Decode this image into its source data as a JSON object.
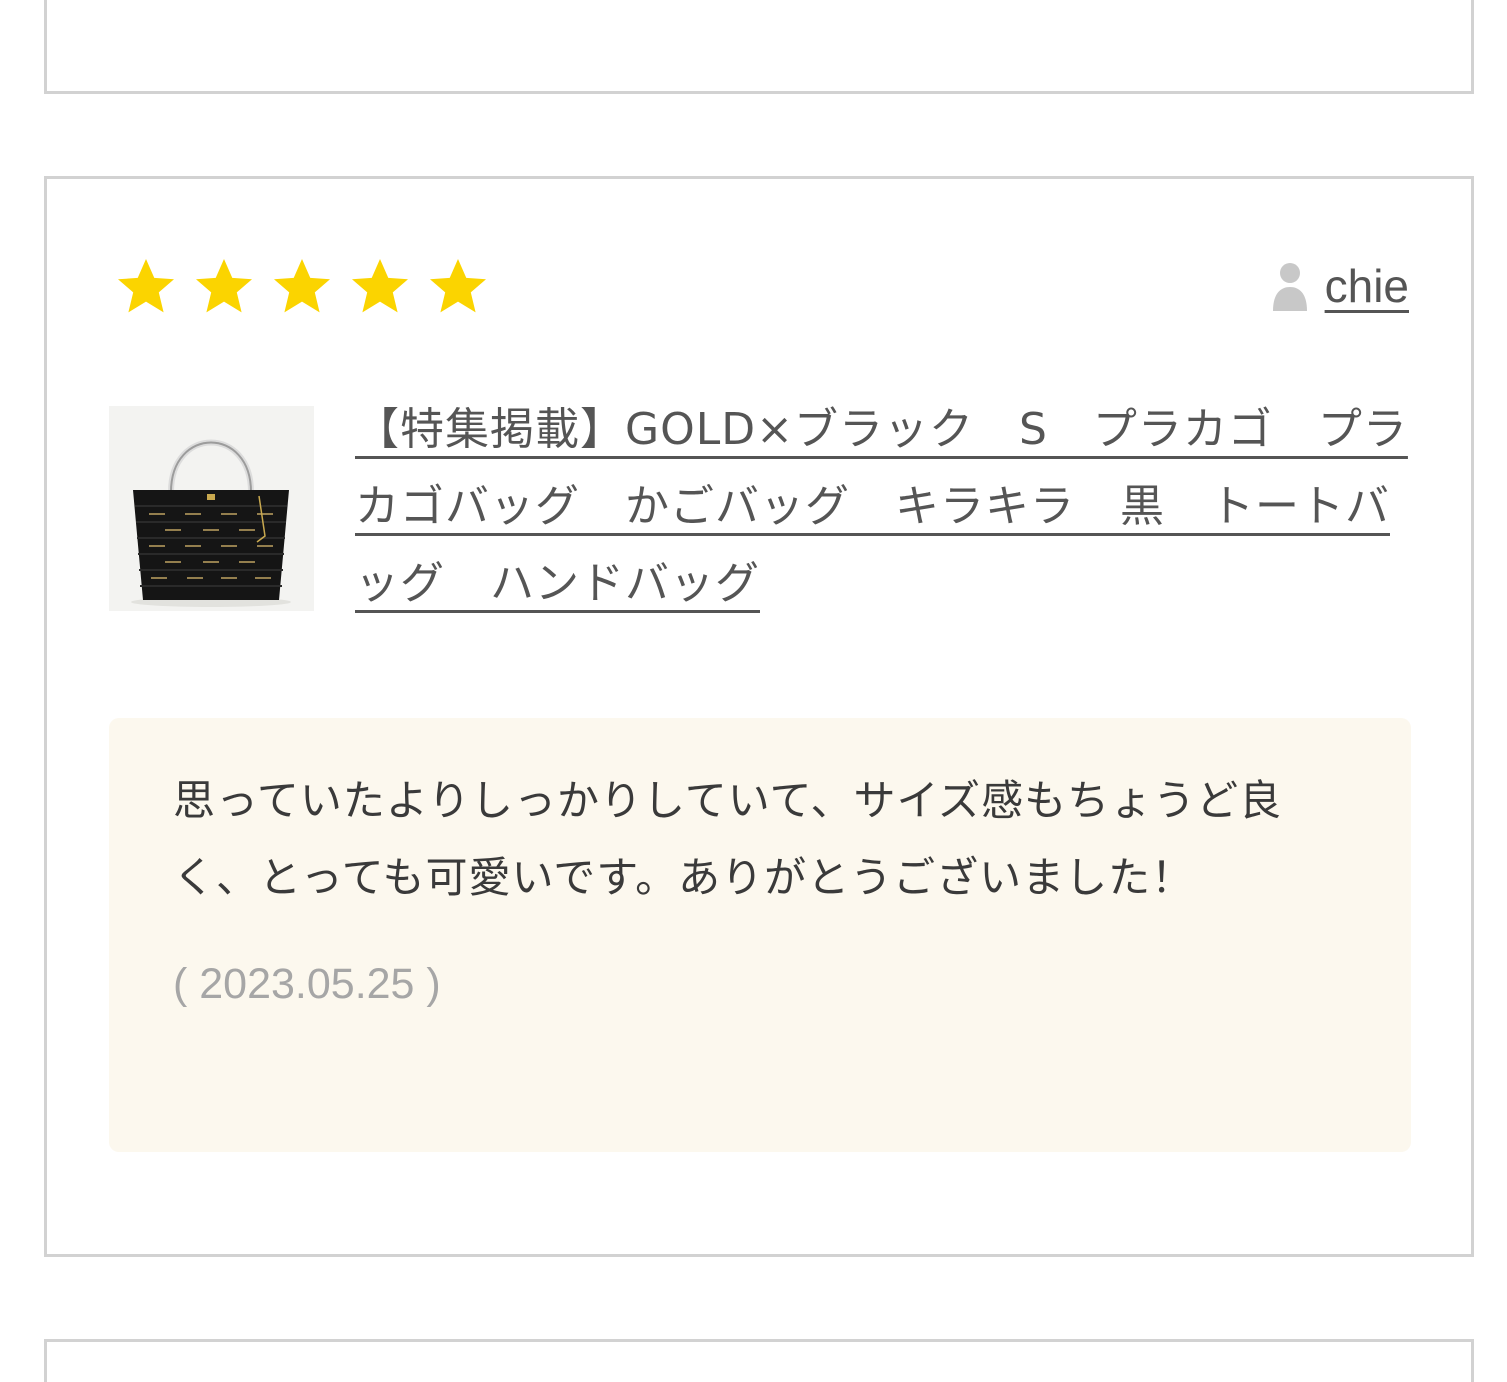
{
  "review": {
    "rating": 5,
    "max_rating": 5,
    "star_color": "#fbd400",
    "reviewer_name": "chie",
    "reviewer_icon": "person-icon",
    "product_title": "【特集掲載】GOLD×ブラック　S　プラカゴ　プラカゴバッグ　かごバッグ　キラキラ　黒　トートバッグ　ハンドバッグ",
    "product_image": "black-basket-bag-thumbnail",
    "text": "思っていたよりしっかりしていて、サイズ感もちょうど良く、とっても可愛いです。ありがとうございました！",
    "date": "( 2023.05.25 )"
  },
  "colors": {
    "border": "#d2d2d2",
    "review_bg": "#fcf8ee",
    "link_text": "#555555",
    "date_text": "#a6a6a6"
  }
}
